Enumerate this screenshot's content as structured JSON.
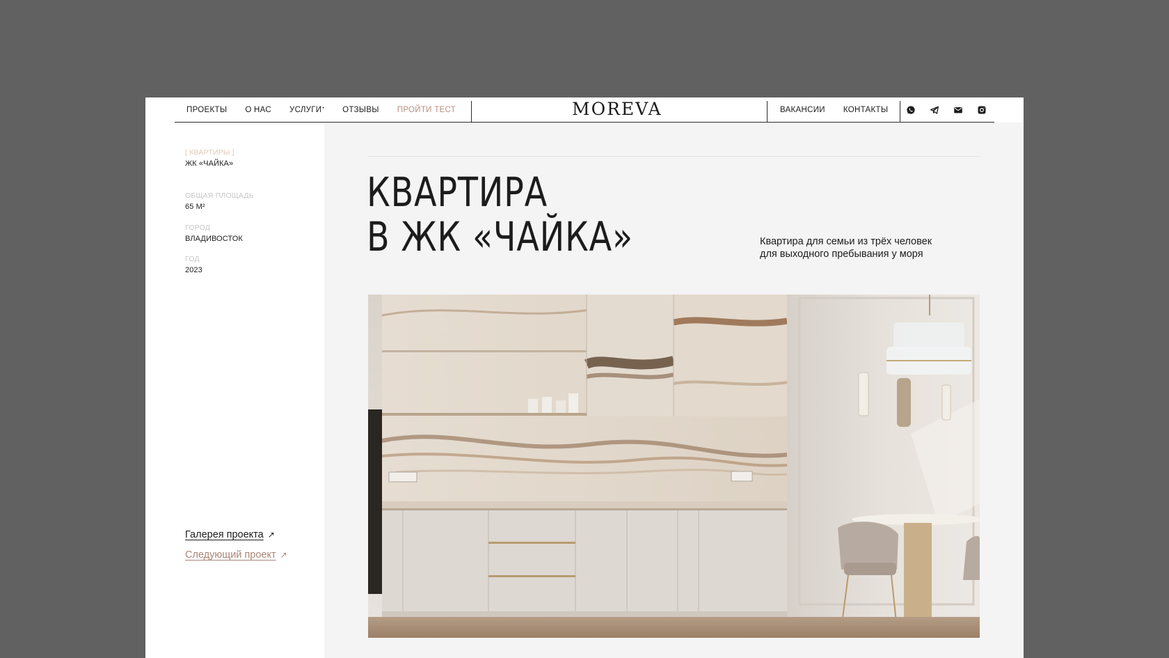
{
  "header": {
    "nav_left": [
      {
        "label": "ПРОЕКТЫ"
      },
      {
        "label": "О НАС"
      },
      {
        "label": "УСЛУГИ",
        "marker": "•"
      },
      {
        "label": "ОТЗЫВЫ"
      },
      {
        "label": "ПРОЙТИ ТЕСТ"
      }
    ],
    "logo": "MOREVA",
    "nav_right": [
      {
        "label": "ВАКАНСИИ"
      },
      {
        "label": "КОНТАКТЫ"
      }
    ],
    "icons": [
      "whatsapp-icon",
      "telegram-icon",
      "mail-icon",
      "instagram-icon"
    ]
  },
  "sidebar": {
    "category": "[ КВАРТИРЫ ]",
    "project_name": "ЖК «ЧАЙКА»",
    "area_label": "ОБЩАЯ ПЛОЩАДЬ",
    "area_value": "65 М²",
    "city_label": "ГОРОД",
    "city_value": "ВЛАДИВОСТОК",
    "year_label": "ГОД",
    "year_value": "2023",
    "gallery_link": "Галерея проекта",
    "next_link": "Следующий проект",
    "link_arrow": "↗"
  },
  "main": {
    "title_line1": "КВАРТИРА",
    "title_line2": "В ЖК «ЧАЙКА»",
    "subtitle_line1": "Квартира для семьи из трёх человек",
    "subtitle_line2": "для выходного пребывания у моря"
  },
  "colors": {
    "backdrop": "#616161",
    "accent": "#b98e7f",
    "panel": "#f4f4f4",
    "text": "#1c1c1c"
  }
}
